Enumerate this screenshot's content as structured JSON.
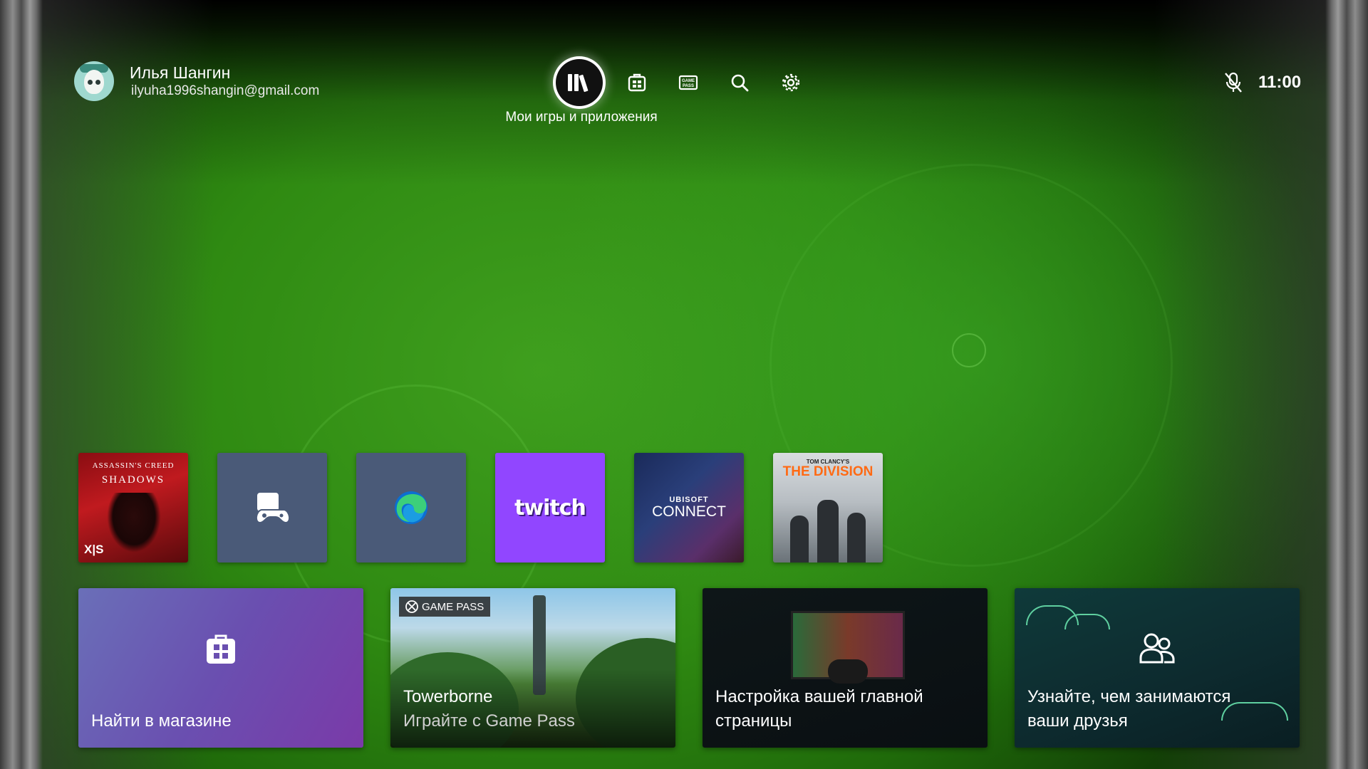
{
  "profile": {
    "name": "Илья Шангин",
    "email": "ilyuha1996shangin@gmail.com"
  },
  "nav": {
    "items": [
      {
        "icon": "library-icon",
        "label": "Мои игры и приложения",
        "active": true
      },
      {
        "icon": "store-icon"
      },
      {
        "icon": "game-pass-icon",
        "text": "GAME PASS"
      },
      {
        "icon": "search-icon"
      },
      {
        "icon": "gear-icon"
      }
    ],
    "active_label": "Мои игры и приложения"
  },
  "status": {
    "mic_icon": "mic-muted-icon",
    "time": "11:00"
  },
  "tiles": [
    {
      "id": "assassins-creed-shadows",
      "title_line1": "ASSASSIN'S CREED",
      "title_line2": "SHADOWS",
      "badge": "X|S",
      "color": "#c01a1f"
    },
    {
      "id": "game-controller-app",
      "icon": "controller-icon",
      "color": "#4a5a78"
    },
    {
      "id": "microsoft-edge",
      "icon": "edge-icon",
      "color": "#4a5a78"
    },
    {
      "id": "twitch",
      "label": "twitch",
      "color": "#9146ff"
    },
    {
      "id": "ubisoft-connect",
      "brand_small": "UBISOFT",
      "brand_big": "CONNECT"
    },
    {
      "id": "the-division",
      "brand_small": "TOM CLANCY'S",
      "title": "THE DIVISION",
      "color": "#ff6a14"
    }
  ],
  "cards": [
    {
      "id": "store",
      "title": "Найти в магазине",
      "icon": "store-icon"
    },
    {
      "id": "towerborne",
      "badge": "GAME PASS",
      "title": "Towerborne",
      "subtitle": "Играйте с Game Pass"
    },
    {
      "id": "customize-home",
      "title_line1": "Настройка вашей главной",
      "title_line2": "страницы"
    },
    {
      "id": "friends",
      "title_line1": "Узнайте, чем занимаются",
      "title_line2": "ваши друзья",
      "icon": "friends-icon"
    }
  ]
}
